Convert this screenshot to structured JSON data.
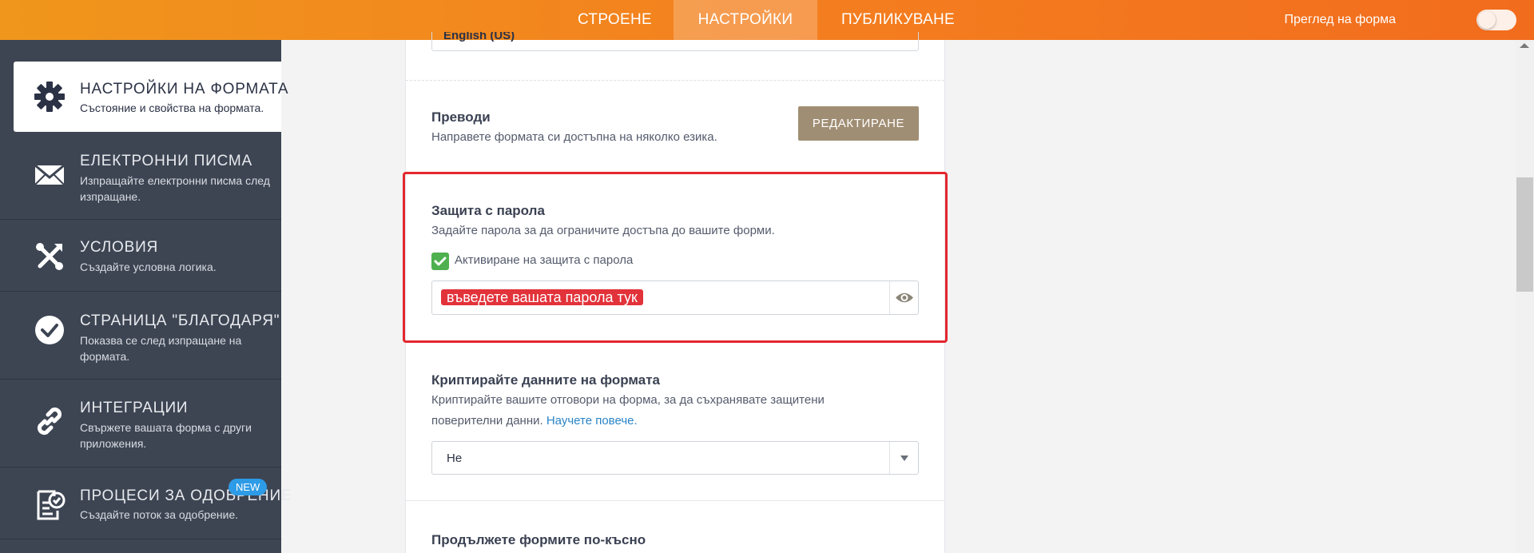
{
  "header": {
    "tabs": [
      {
        "label": "СТРОЕНЕ",
        "active": false
      },
      {
        "label": "НАСТРОЙКИ",
        "active": true
      },
      {
        "label": "ПУБЛИКУВАНЕ",
        "active": false
      }
    ],
    "preview_label": "Преглед на форма",
    "preview_toggle_on": false
  },
  "sidebar": {
    "items": [
      {
        "title": "НАСТРОЙКИ НА ФОРМАТА",
        "desc": "Състояние и свойства на формата.",
        "icon": "gear-icon",
        "active": true
      },
      {
        "title": "ЕЛЕКТРОННИ ПИСМА",
        "desc": "Изпращайте електронни писма след изпращане.",
        "icon": "envelope-icon",
        "active": false
      },
      {
        "title": "УСЛОВИЯ",
        "desc": "Създайте условна логика.",
        "icon": "conditions-icon",
        "active": false
      },
      {
        "title": "СТРАНИЦА \"БЛАГОДАРЯ\"",
        "desc": "Показва се след изпращане на формата.",
        "icon": "check-circle-icon",
        "active": false
      },
      {
        "title": "ИНТЕГРАЦИИ",
        "desc": "Свържете вашата форма с други приложения.",
        "icon": "link-icon",
        "active": false
      },
      {
        "title": "ПРОЦЕСИ ЗА ОДОБРЕНИЕ",
        "desc": "Създайте поток за одобрение.",
        "icon": "approval-icon",
        "active": false,
        "badge": "NEW"
      }
    ]
  },
  "main": {
    "language_value": "English (US)",
    "translations": {
      "title": "Преводи",
      "desc": "Направете формата си достъпна на няколко езика.",
      "button": "РЕДАКТИРАНЕ"
    },
    "password": {
      "title": "Защита с парола",
      "desc": "Задайте парола за да ограничите достъпа до вашите форми.",
      "checkbox_label": "Активиране на защита с парола",
      "checked": true,
      "placeholder": "въведете вашата парола тук"
    },
    "encrypt": {
      "title": "Криптирайте данните на формата",
      "desc": "Криптирайте вашите отговори на форма, за да съхранявате защитени поверителни данни.",
      "link": "Научете повече.",
      "select_value": "Не"
    },
    "continue_later": {
      "title": "Продължете формите по-късно"
    }
  },
  "colors": {
    "accent": "#f47e1f",
    "sidebar_bg": "#3d4553",
    "highlight": "#e4262e",
    "edit_button": "#a08e74",
    "checkbox": "#4fb04f",
    "link": "#2a85c7"
  }
}
